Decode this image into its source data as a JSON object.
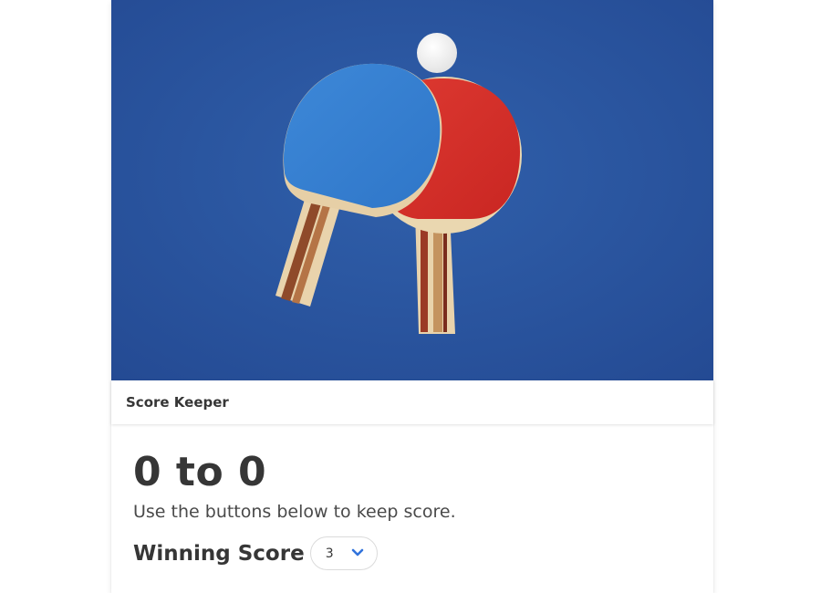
{
  "header": {
    "title": "Score Keeper"
  },
  "score": {
    "title": "0 to 0",
    "subtitle": "Use the buttons below to keep score."
  },
  "winning_score": {
    "label": "Winning Score",
    "selected_value": "3"
  },
  "hero_image": {
    "subject": "two table tennis paddles and ball on blue surface"
  },
  "colors": {
    "table_blue": "#2d56a0",
    "accent": "#3273dc",
    "text": "#363636"
  }
}
